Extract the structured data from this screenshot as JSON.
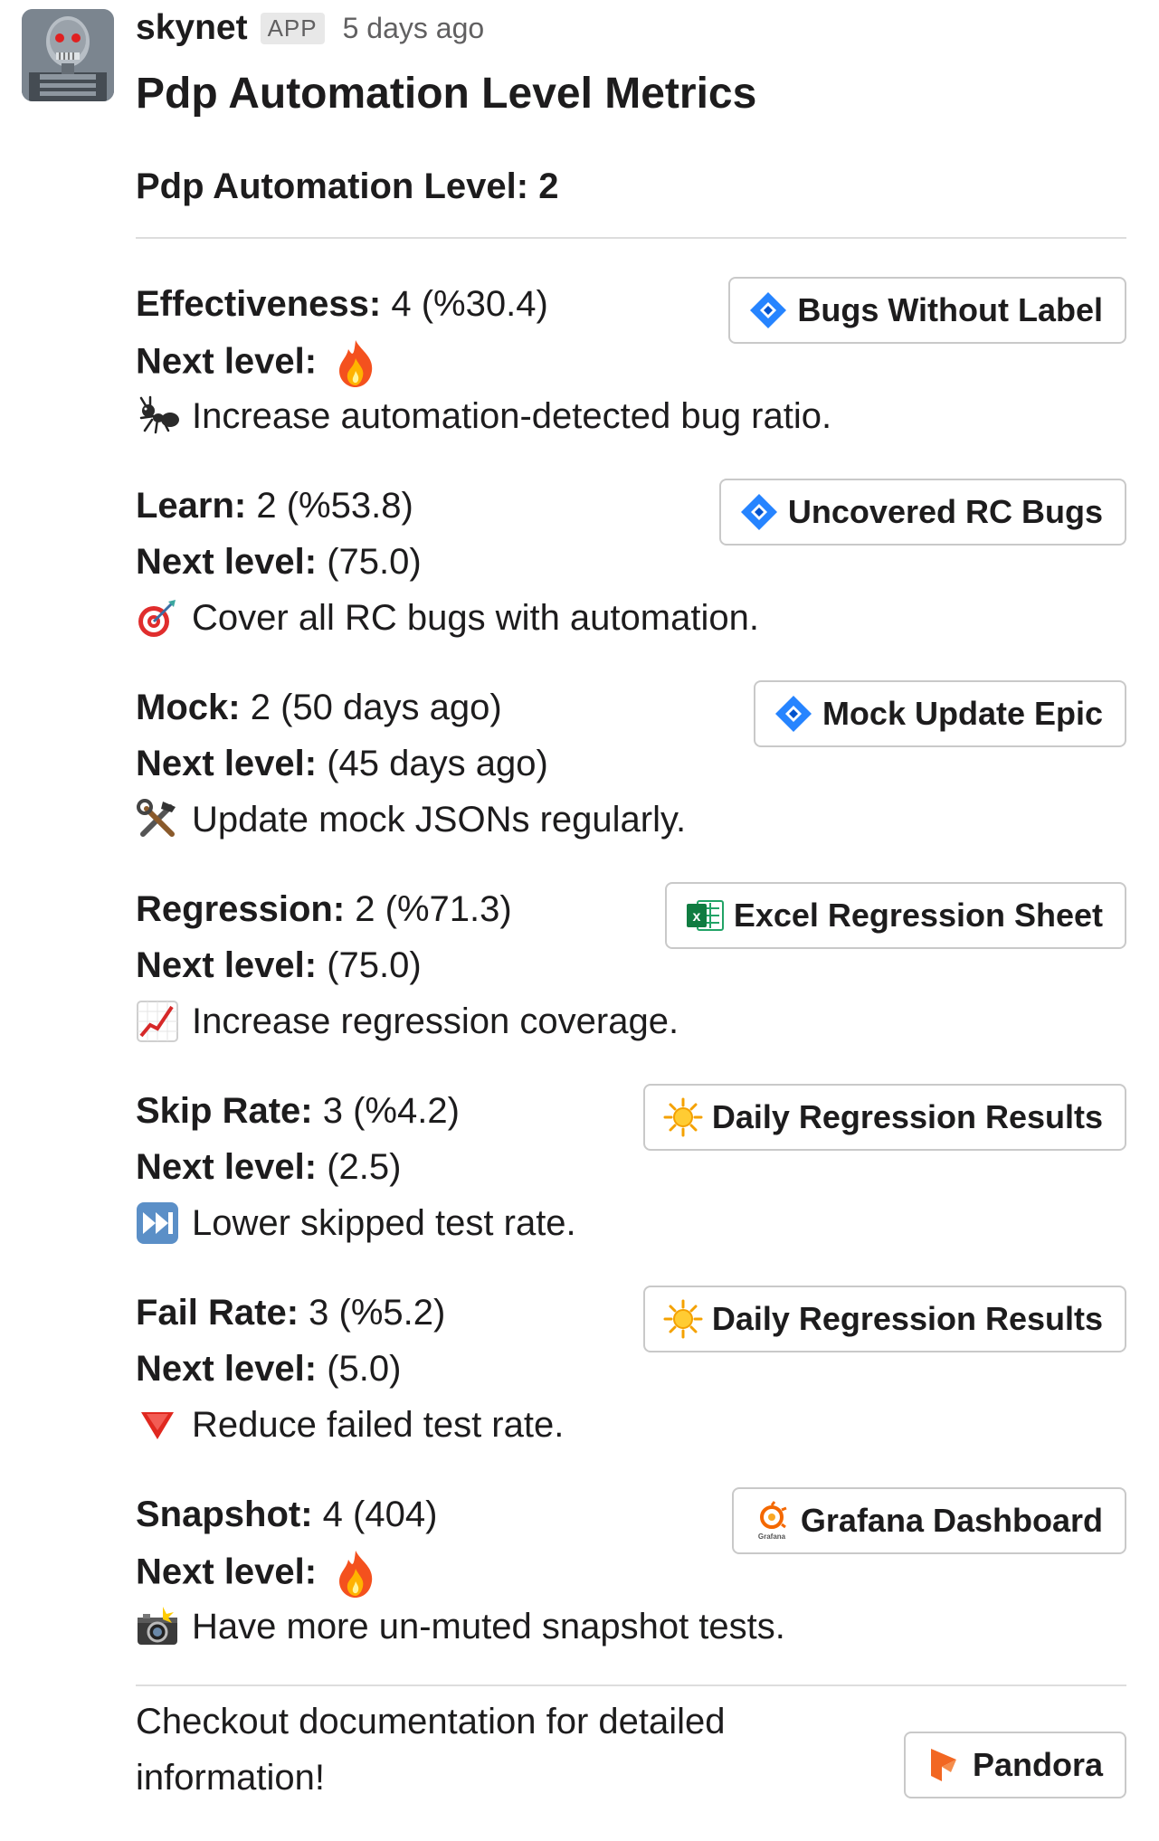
{
  "header": {
    "sender": "skynet",
    "badge": "APP",
    "timestamp": "5 days ago"
  },
  "title": "Pdp Automation Level Metrics",
  "level_line": "Pdp Automation Level: 2",
  "sections": [
    {
      "label": "Effectiveness:",
      "value": "4 (%30.4)",
      "next_label": "Next level:",
      "next_value": "",
      "next_is_fire": true,
      "hint_icon": "ant-icon",
      "hint": "Increase automation-detected bug ratio.",
      "button": {
        "label": "Bugs Without Label",
        "icon": "jira-icon"
      }
    },
    {
      "label": "Learn:",
      "value": "2 (%53.8)",
      "next_label": "Next level:",
      "next_value": "(75.0)",
      "next_is_fire": false,
      "hint_icon": "target-icon",
      "hint": "Cover all RC bugs with automation.",
      "button": {
        "label": "Uncovered RC Bugs",
        "icon": "jira-icon"
      }
    },
    {
      "label": "Mock:",
      "value": "2 (50 days ago)",
      "next_label": "Next level:",
      "next_value": "(45 days ago)",
      "next_is_fire": false,
      "hint_icon": "tools-icon",
      "hint": "Update mock JSONs regularly.",
      "button": {
        "label": "Mock Update Epic",
        "icon": "jira-icon"
      }
    },
    {
      "label": "Regression:",
      "value": "2 (%71.3)",
      "next_label": "Next level:",
      "next_value": "(75.0)",
      "next_is_fire": false,
      "hint_icon": "chart-up-icon",
      "hint": "Increase regression coverage.",
      "button": {
        "label": "Excel Regression Sheet",
        "icon": "excel-icon"
      }
    },
    {
      "label": "Skip Rate:",
      "value": "3 (%4.2)",
      "next_label": "Next level:",
      "next_value": "(2.5)",
      "next_is_fire": false,
      "hint_icon": "fast-forward-icon",
      "hint": "Lower skipped test rate.",
      "button": {
        "label": "Daily Regression Results",
        "icon": "sun-icon"
      }
    },
    {
      "label": "Fail Rate:",
      "value": "3 (%5.2)",
      "next_label": "Next level:",
      "next_value": "(5.0)",
      "next_is_fire": false,
      "hint_icon": "red-triangle-icon",
      "hint": "Reduce failed test rate.",
      "button": {
        "label": "Daily Regression Results",
        "icon": "sun-icon"
      }
    },
    {
      "label": "Snapshot:",
      "value": "4 (404)",
      "next_label": "Next level:",
      "next_value": "",
      "next_is_fire": true,
      "hint_icon": "camera-flash-icon",
      "hint": "Have more un-muted snapshot tests.",
      "button": {
        "label": "Grafana Dashboard",
        "icon": "grafana-icon"
      }
    }
  ],
  "footer": {
    "text": "Checkout documentation for detailed information!",
    "button": {
      "label": "Pandora",
      "icon": "pandora-icon"
    }
  }
}
